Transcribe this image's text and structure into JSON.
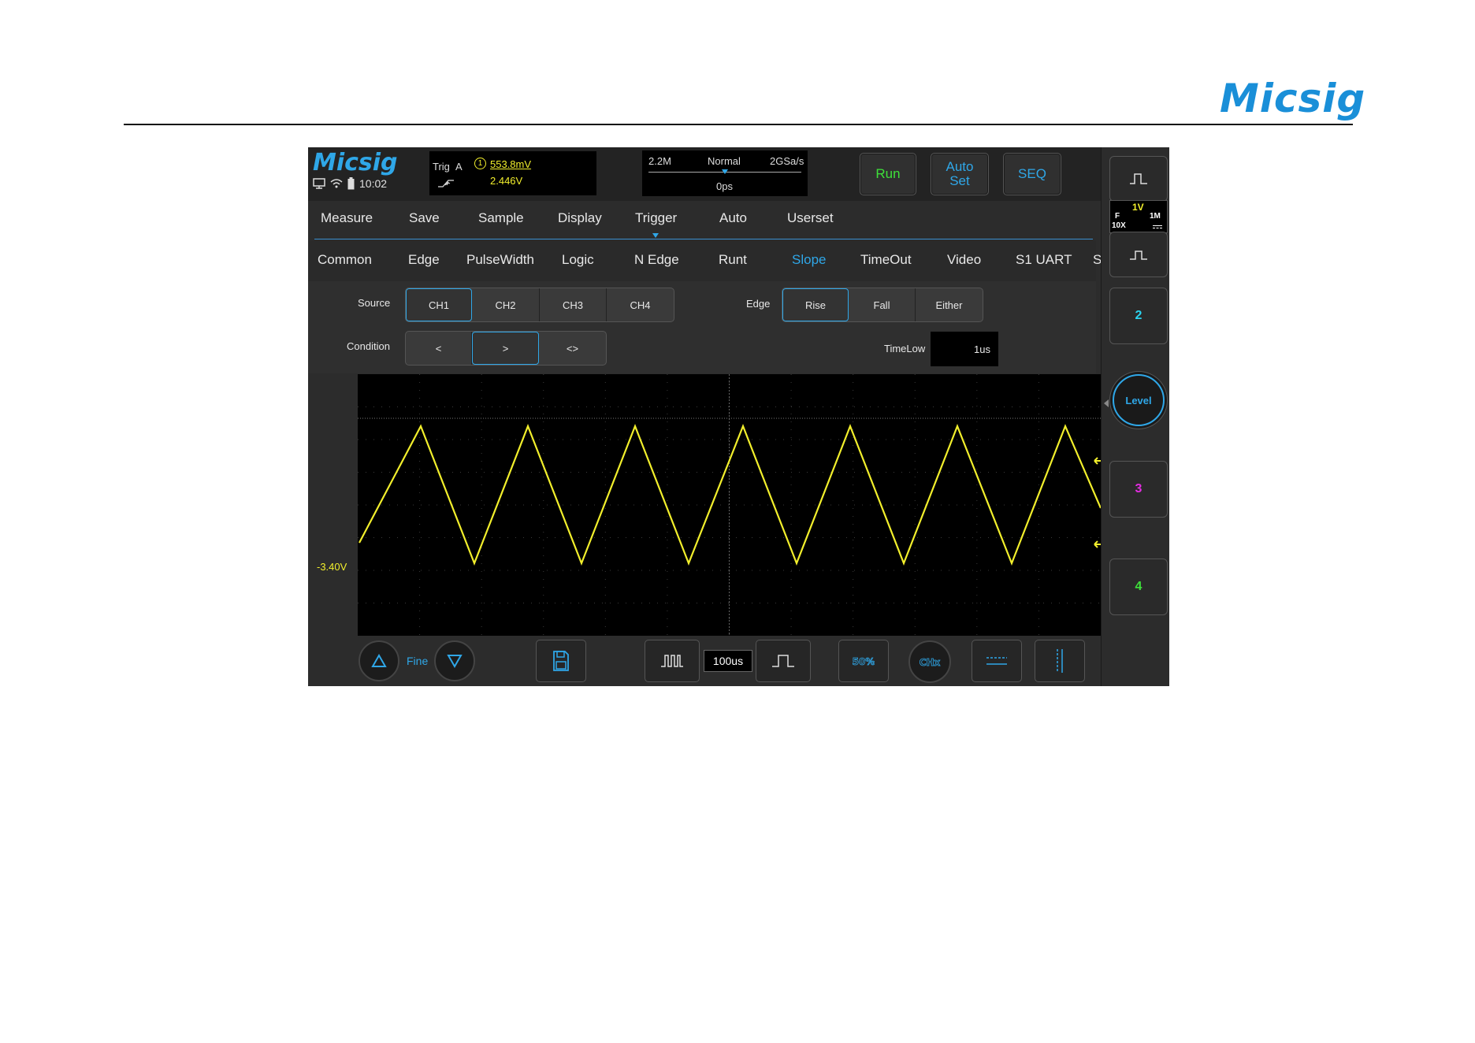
{
  "brand": "Micsig",
  "screen": {
    "app_logo": "Micsig",
    "status_time": "10:02",
    "trigger_info": {
      "label": "Trig",
      "channel": "A",
      "channel_num": "1",
      "level": "553.8mV",
      "value2": "2.446V"
    },
    "timebase_info": {
      "mem_depth": "2.2M",
      "mode": "Normal",
      "sample_rate": "2GSa/s",
      "position": "0ps"
    },
    "top_buttons": {
      "run": "Run",
      "auto_set": "Auto\nSet",
      "seq": "SEQ"
    },
    "menu_items": [
      "Measure",
      "Save",
      "Sample",
      "Display",
      "Trigger",
      "Auto",
      "Userset"
    ],
    "menu_selected": "Trigger",
    "trigger_types": [
      "Common",
      "Edge",
      "PulseWidth",
      "Logic",
      "N Edge",
      "Runt",
      "Slope",
      "TimeOut",
      "Video",
      "S1 UART",
      "S"
    ],
    "trigger_type_selected": "Slope",
    "source": {
      "label": "Source",
      "options": [
        "CH1",
        "CH2",
        "CH3",
        "CH4"
      ],
      "selected": "CH1"
    },
    "edge": {
      "label": "Edge",
      "options": [
        "Rise",
        "Fall",
        "Either"
      ],
      "selected": "Rise"
    },
    "condition": {
      "label": "Condition",
      "options": [
        "<",
        ">",
        "<>"
      ],
      "selected": ">"
    },
    "timelow": {
      "label": "TimeLow",
      "value": "1us"
    },
    "channel_offset_label": "-3.40V",
    "channel_marker": "1",
    "bottom": {
      "fine_label": "Fine",
      "timebase": "100us"
    },
    "right_panel": {
      "ch1_volts": "1V",
      "ch1_coupling": "F",
      "ch1_probe": "10X",
      "ch1_impedance": "1M",
      "ch2": "2",
      "level": "Level",
      "ch3": "3",
      "ch4": "4"
    },
    "colors": {
      "ch1": "#f2ef2c",
      "ch2": "#2ad4f0",
      "ch3": "#e22ce0",
      "ch4": "#3ee03a",
      "accent": "#2fa7e8",
      "run": "#3ee03a"
    }
  }
}
